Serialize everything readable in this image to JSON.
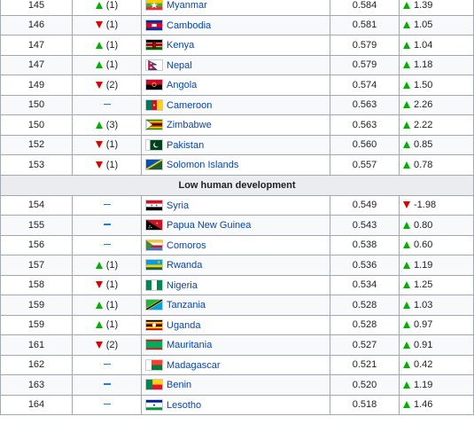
{
  "section_header": "Low human development",
  "rows_top": [
    {
      "rank": "145",
      "change_dir": "up",
      "change": "(1)",
      "country": "Myanmar",
      "flag": "myanmar-flag-icon",
      "hdi": "0.584",
      "growth_dir": "up",
      "growth": "1.39"
    },
    {
      "rank": "146",
      "change_dir": "down",
      "change": "(1)",
      "country": "Cambodia",
      "flag": "cambodia-flag-icon",
      "hdi": "0.581",
      "growth_dir": "up",
      "growth": "1.05"
    },
    {
      "rank": "147",
      "change_dir": "up",
      "change": "(1)",
      "country": "Kenya",
      "flag": "kenya-flag-icon",
      "hdi": "0.579",
      "growth_dir": "up",
      "growth": "1.04"
    },
    {
      "rank": "147",
      "change_dir": "up",
      "change": "(1)",
      "country": "Nepal",
      "flag": "nepal-flag-icon",
      "hdi": "0.579",
      "growth_dir": "up",
      "growth": "1.18"
    },
    {
      "rank": "149",
      "change_dir": "down",
      "change": "(2)",
      "country": "Angola",
      "flag": "angola-flag-icon",
      "hdi": "0.574",
      "growth_dir": "up",
      "growth": "1.50"
    },
    {
      "rank": "150",
      "change_dir": "none",
      "change": "",
      "country": "Cameroon",
      "flag": "cameroon-flag-icon",
      "hdi": "0.563",
      "growth_dir": "up",
      "growth": "2.26"
    },
    {
      "rank": "150",
      "change_dir": "up",
      "change": "(3)",
      "country": "Zimbabwe",
      "flag": "zimbabwe-flag-icon",
      "hdi": "0.563",
      "growth_dir": "up",
      "growth": "2.22"
    },
    {
      "rank": "152",
      "change_dir": "down",
      "change": "(1)",
      "country": "Pakistan",
      "flag": "pakistan-flag-icon",
      "hdi": "0.560",
      "growth_dir": "up",
      "growth": "0.85"
    },
    {
      "rank": "153",
      "change_dir": "down",
      "change": "(1)",
      "country": "Solomon Islands",
      "flag": "solomon-islands-flag-icon",
      "hdi": "0.557",
      "growth_dir": "up",
      "growth": "0.78"
    }
  ],
  "rows_bottom": [
    {
      "rank": "154",
      "change_dir": "none",
      "change": "",
      "country": "Syria",
      "flag": "syria-flag-icon",
      "hdi": "0.549",
      "growth_dir": "down",
      "growth": "-1.98"
    },
    {
      "rank": "155",
      "change_dir": "none",
      "change": "",
      "country": "Papua New Guinea",
      "flag": "papua-new-guinea-flag-icon",
      "hdi": "0.543",
      "growth_dir": "up",
      "growth": "0.80"
    },
    {
      "rank": "156",
      "change_dir": "none",
      "change": "",
      "country": "Comoros",
      "flag": "comoros-flag-icon",
      "hdi": "0.538",
      "growth_dir": "up",
      "growth": "0.60"
    },
    {
      "rank": "157",
      "change_dir": "up",
      "change": "(1)",
      "country": "Rwanda",
      "flag": "rwanda-flag-icon",
      "hdi": "0.536",
      "growth_dir": "up",
      "growth": "1.19"
    },
    {
      "rank": "158",
      "change_dir": "down",
      "change": "(1)",
      "country": "Nigeria",
      "flag": "nigeria-flag-icon",
      "hdi": "0.534",
      "growth_dir": "up",
      "growth": "1.25"
    },
    {
      "rank": "159",
      "change_dir": "up",
      "change": "(1)",
      "country": "Tanzania",
      "flag": "tanzania-flag-icon",
      "hdi": "0.528",
      "growth_dir": "up",
      "growth": "1.03"
    },
    {
      "rank": "159",
      "change_dir": "up",
      "change": "(1)",
      "country": "Uganda",
      "flag": "uganda-flag-icon",
      "hdi": "0.528",
      "growth_dir": "up",
      "growth": "0.97"
    },
    {
      "rank": "161",
      "change_dir": "down",
      "change": "(2)",
      "country": "Mauritania",
      "flag": "mauritania-flag-icon",
      "hdi": "0.527",
      "growth_dir": "up",
      "growth": "0.91"
    },
    {
      "rank": "162",
      "change_dir": "none",
      "change": "",
      "country": "Madagascar",
      "flag": "madagascar-flag-icon",
      "hdi": "0.521",
      "growth_dir": "up",
      "growth": "0.42"
    },
    {
      "rank": "163",
      "change_dir": "none",
      "change": "",
      "country": "Benin",
      "flag": "benin-flag-icon",
      "hdi": "0.520",
      "growth_dir": "up",
      "growth": "1.19"
    },
    {
      "rank": "164",
      "change_dir": "none",
      "change": "",
      "country": "Lesotho",
      "flag": "lesotho-flag-icon",
      "hdi": "0.518",
      "growth_dir": "up",
      "growth": "1.46"
    }
  ],
  "colors": {
    "up": "#00b000",
    "down": "#dd0000",
    "unchanged": "#1b7fd8",
    "link": "#0645ad"
  }
}
